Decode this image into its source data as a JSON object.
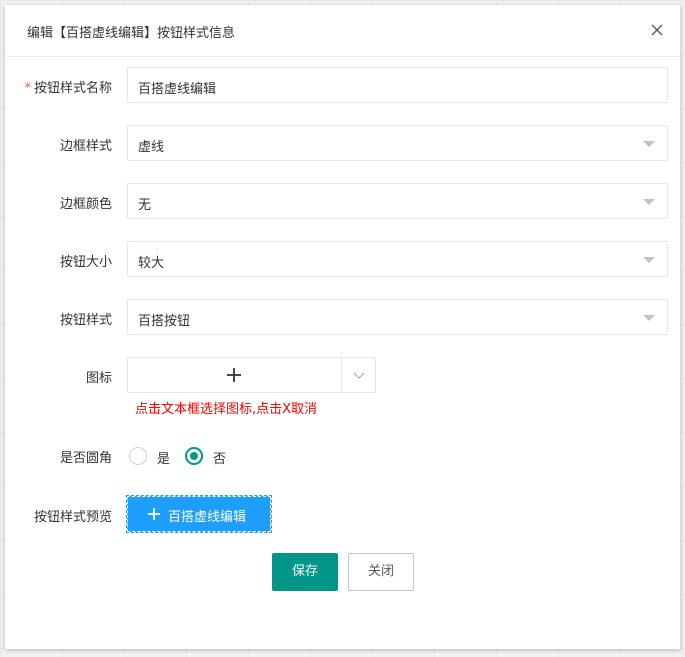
{
  "dialog": {
    "title": "编辑【百搭虚线编辑】按钮样式信息",
    "close_icon": "close-icon"
  },
  "form": {
    "name": {
      "required_mark": "*",
      "label": "按钮样式名称",
      "value": "百搭虚线编辑"
    },
    "border_style": {
      "label": "边框样式",
      "value": "虚线"
    },
    "border_color": {
      "label": "边框颜色",
      "value": "无"
    },
    "button_size": {
      "label": "按钮大小",
      "value": "较大"
    },
    "button_style": {
      "label": "按钮样式",
      "value": "百搭按钮"
    },
    "icon": {
      "label": "图标",
      "hint": "点击文本框选择图标,点击X取消",
      "icon": "plus-icon"
    },
    "rounded": {
      "label": "是否圆角",
      "options": [
        {
          "label": "是",
          "checked": false
        },
        {
          "label": "否",
          "checked": true
        }
      ]
    },
    "preview": {
      "label": "按钮样式预览",
      "button_text": "百搭虚线编辑",
      "icon": "plus-icon"
    }
  },
  "actions": {
    "save_label": "保存",
    "close_label": "关闭"
  },
  "colors": {
    "primary": "#009688",
    "preview": "#1e9fff",
    "hint": "#ff0000",
    "required": "#ff5722"
  }
}
